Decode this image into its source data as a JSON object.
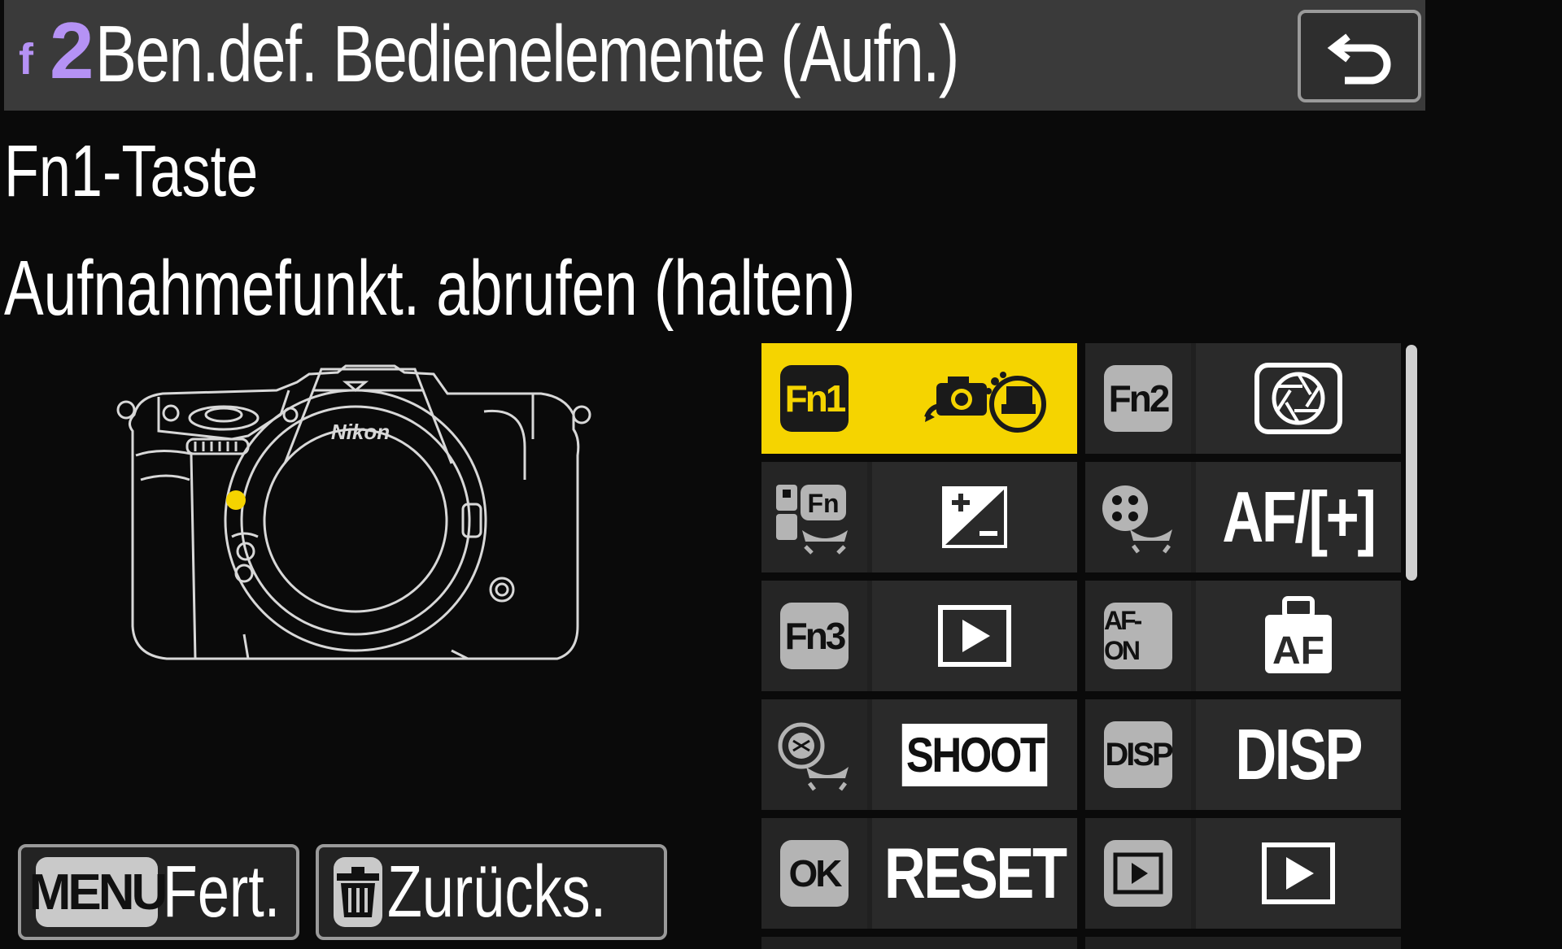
{
  "header": {
    "menu_letter": "f",
    "menu_number": "2",
    "title": "Ben.def. Bedienelemente (Aufn.)"
  },
  "setting": {
    "name": "Fn1-Taste",
    "value": "Aufnahmefunkt. abrufen (halten)"
  },
  "camera": {
    "brand": "Nikon"
  },
  "controls": [
    {
      "button": "Fn1",
      "function_icon": "recall-shooting-functions-hold-icon",
      "selected": true
    },
    {
      "button": "Fn2",
      "function_icon": "aperture-icon",
      "selected": false
    },
    {
      "button": "Fn",
      "function_icon": "exposure-compensation-icon",
      "selected": false
    },
    {
      "button": "",
      "function": "AF/[+]",
      "selected": false
    },
    {
      "button": "Fn3",
      "function_icon": "playback-icon",
      "selected": false
    },
    {
      "button": "AF-ON",
      "function": "AF",
      "selected": false
    },
    {
      "button": "",
      "function": "SHOOT",
      "selected": false
    },
    {
      "button": "DISP",
      "function": "DISP",
      "selected": false
    },
    {
      "button": "OK",
      "function": "RESET",
      "selected": false
    },
    {
      "button": "",
      "function_icon": "playback-icon",
      "selected": false
    }
  ],
  "footer": {
    "menu_key": "MENU",
    "confirm_label": "Fert.",
    "reset_label": "Zurücks."
  },
  "colors": {
    "accent": "#f5d400",
    "menu_code": "#b592f5",
    "header_bg": "#3a3a3a",
    "background": "#0a0a0a"
  }
}
